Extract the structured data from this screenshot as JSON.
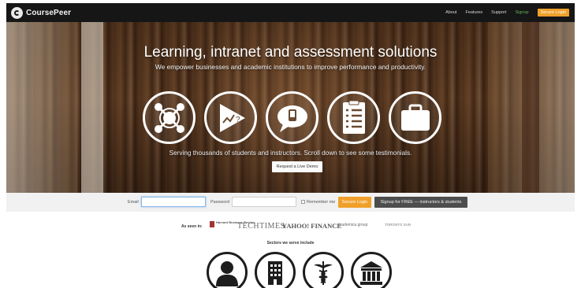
{
  "nav": {
    "brand": "CoursePeer",
    "links": [
      "About",
      "Features",
      "Support",
      "Signup"
    ],
    "login": "Secure Login",
    "signup_color": "#5fb85f",
    "accent": "#f0a02a"
  },
  "hero": {
    "title": "Learning, intranet and assessment solutions",
    "subtitle": "We empower businesses and academic institutions to improve performance and productivity.",
    "icons": [
      "network-icon",
      "presentation-play-icon",
      "chat-bubble-icon",
      "checklist-icon",
      "briefcase-icon"
    ],
    "tagline": "Serving thousands of students and instructors. Scroll down to see some testimonials.",
    "demo_button": "Request a Live Demo"
  },
  "login_bar": {
    "email_label": "Email",
    "password_label": "Password",
    "remember_label": "Remember me",
    "login_button": "Secure Login",
    "signup_button": "Signup for FREE — instructors & students"
  },
  "press": {
    "label": "As seen in:",
    "outlets": [
      "Harvard Business Review",
      "TECHTIMES",
      "YAHOO! FINANCE",
      "academica group",
      "TORONTO SUN"
    ]
  },
  "sectors": {
    "title": "Sectors we serve include",
    "icons": [
      "person-icon",
      "office-building-icon",
      "medical-caduceus-icon",
      "government-building-icon"
    ]
  }
}
